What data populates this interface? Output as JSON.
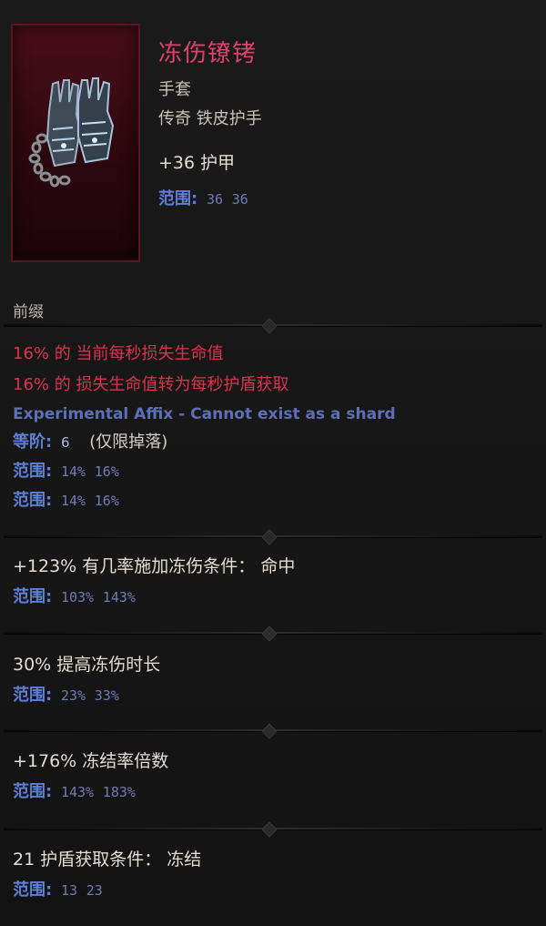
{
  "item": {
    "name": "冻伤镣铐",
    "type": "手套",
    "rarity": "传奇 铁皮护手",
    "base_stat": "+36 护甲",
    "base_range": {
      "label": "范围:",
      "min": "36",
      "max": "36"
    },
    "icon": "chained-gauntlets-icon"
  },
  "prefix_label": "前缀",
  "range_label": "范围:",
  "affix_experimental": {
    "lines": [
      "16% 的 当前每秒损失生命值",
      "16% 的 损失生命值转为每秒护盾获取"
    ],
    "note": "Experimental Affix - Cannot exist as a shard",
    "tier_label": "等阶:",
    "tier_value": "6",
    "tier_note": "(仅限掉落)",
    "ranges": [
      {
        "min": "14%",
        "max": "16%"
      },
      {
        "min": "14%",
        "max": "16%"
      }
    ]
  },
  "affixes": [
    {
      "text": "+123% 有几率施加冻伤条件：  命中",
      "min": "103%",
      "max": "143%"
    },
    {
      "text": "30% 提高冻伤时长",
      "min": "23%",
      "max": "33%"
    },
    {
      "text": "+176% 冻结率倍数",
      "min": "143%",
      "max": "183%"
    },
    {
      "text": "21 护盾获取条件：  冻结",
      "min": "13",
      "max": "23"
    }
  ],
  "colors": {
    "name": "#e0416f",
    "affix_red": "#d9344c",
    "range_label": "#5e7fd8",
    "range_value": "#6d7cb4",
    "experimental": "#5d6fb8"
  }
}
